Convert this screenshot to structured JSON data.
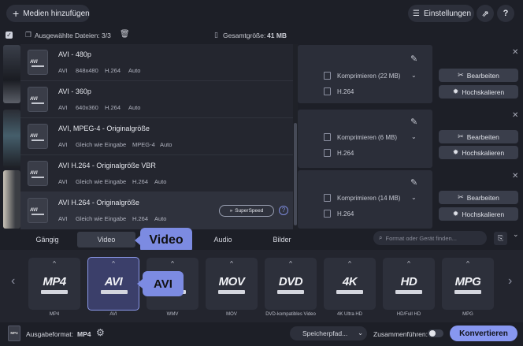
{
  "topbar": {
    "add_media": "Medien hinzufügen",
    "settings": "Einstellungen",
    "share_glyph": "⇗",
    "help_glyph": "?"
  },
  "filebar": {
    "selected_label": "Ausgewählte Dateien: 3/3",
    "total_label": "Gesamtgröße:",
    "total_value": "41 MB"
  },
  "rows": [
    {
      "compress": "Komprimieren (22 MB)",
      "codec": "H.264",
      "edit": "Bearbeiten",
      "upscale": "Hochskalieren"
    },
    {
      "compress": "Komprimieren (6 MB)",
      "codec": "H.264",
      "edit": "Bearbeiten",
      "upscale": "Hochskalieren"
    },
    {
      "compress": "Komprimieren (14 MB)",
      "codec": "H.264",
      "edit": "Bearbeiten",
      "upscale": "Hochskalieren"
    }
  ],
  "dropdown": {
    "items": [
      {
        "title": "AVI - 480p",
        "icon": "AVI",
        "container": "AVI",
        "resolution": "848x480",
        "codec": "H.264",
        "audio": "Auto"
      },
      {
        "title": "AVI - 360p",
        "icon": "AVI",
        "container": "AVI",
        "resolution": "640x360",
        "codec": "H.264",
        "audio": "Auto"
      },
      {
        "title": "AVI, MPEG-4 - Originalgröße",
        "icon": "AVI",
        "container": "AVI",
        "resolution": "Gleich wie Eingabe",
        "codec": "MPEG-4",
        "audio": "Auto"
      },
      {
        "title": "AVI H.264 - Originalgröße VBR",
        "icon": "AVI",
        "container": "AVI",
        "resolution": "Gleich wie Eingabe",
        "codec": "H.264",
        "audio": "Auto"
      },
      {
        "title": "AVI H.264 - Originalgröße",
        "icon": "AVI",
        "container": "AVI",
        "resolution": "Gleich wie Eingabe",
        "codec": "H.264",
        "audio": "Auto"
      }
    ],
    "superspeed": "SuperSpeed",
    "help_glyph": "?"
  },
  "tabs": {
    "items": [
      "Gängig",
      "Video",
      "Audio",
      "Bilder"
    ],
    "active": "Video",
    "callout": "Video"
  },
  "search": {
    "placeholder": "Format oder Gerät finden..."
  },
  "tiles": {
    "items": [
      {
        "logo": "MP4",
        "label": "MP4"
      },
      {
        "logo": "AVI",
        "label": "AVI"
      },
      {
        "logo": "",
        "label": "WMV"
      },
      {
        "logo": "MOV",
        "label": "MOV"
      },
      {
        "logo": "DVD",
        "label": "DVD-kompatibles Video"
      },
      {
        "logo": "4K",
        "label": "4K Ultra HD"
      },
      {
        "logo": "HD",
        "label": "HD/Full HD"
      },
      {
        "logo": "MPG",
        "label": "MPG"
      }
    ],
    "selected": "AVI",
    "callout": "AVI"
  },
  "bottombar": {
    "output_label": "Ausgabeformat:",
    "output_value": "MP4",
    "format_icon_text": "MP4",
    "save_path": "Speicherpfad...",
    "merge_label": "Zusammenführen:",
    "convert": "Konvertieren"
  }
}
